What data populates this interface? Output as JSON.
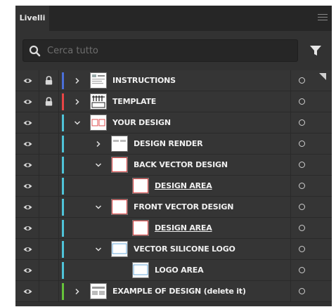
{
  "panel": {
    "tab_label": "Livelli",
    "menu_icon": "hamburger-menu-icon"
  },
  "search": {
    "placeholder": "Cerca tutto",
    "icon": "search-icon",
    "filter_icon": "filter-icon"
  },
  "layers": [
    {
      "label": "INSTRUCTIONS",
      "visible": true,
      "locked": true,
      "color": "#4a6fd8",
      "indent": 0,
      "expanded": false,
      "has_children": true,
      "thumb": "instructions",
      "underline": false
    },
    {
      "label": "TEMPLATE",
      "visible": true,
      "locked": true,
      "color": "#e84545",
      "indent": 0,
      "expanded": false,
      "has_children": true,
      "thumb": "template",
      "underline": false
    },
    {
      "label": "YOUR DESIGN",
      "visible": true,
      "locked": false,
      "color": "#4fc3d8",
      "indent": 0,
      "expanded": true,
      "has_children": true,
      "thumb": "your-design",
      "underline": false
    },
    {
      "label": "DESIGN RENDER",
      "visible": true,
      "locked": false,
      "color": "#4fc3d8",
      "indent": 1,
      "expanded": false,
      "has_children": true,
      "thumb": "render",
      "underline": false
    },
    {
      "label": "BACK VECTOR DESIGN",
      "visible": true,
      "locked": false,
      "color": "#4fc3d8",
      "indent": 1,
      "expanded": true,
      "has_children": true,
      "thumb": "red-frame",
      "underline": false
    },
    {
      "label": "DESIGN AREA",
      "visible": true,
      "locked": false,
      "color": "#4fc3d8",
      "indent": 2,
      "expanded": false,
      "has_children": false,
      "thumb": "red-frame",
      "underline": true
    },
    {
      "label": "FRONT VECTOR DESIGN",
      "visible": true,
      "locked": false,
      "color": "#4fc3d8",
      "indent": 1,
      "expanded": true,
      "has_children": true,
      "thumb": "red-frame",
      "underline": false
    },
    {
      "label": "DESIGN AREA",
      "visible": true,
      "locked": false,
      "color": "#4fc3d8",
      "indent": 2,
      "expanded": false,
      "has_children": false,
      "thumb": "red-frame",
      "underline": true
    },
    {
      "label": "VECTOR SILICONE LOGO",
      "visible": true,
      "locked": false,
      "color": "#4fc3d8",
      "indent": 1,
      "expanded": true,
      "has_children": true,
      "thumb": "blue-frame",
      "underline": false
    },
    {
      "label": "LOGO AREA",
      "visible": true,
      "locked": false,
      "color": "#4fc3d8",
      "indent": 2,
      "expanded": false,
      "has_children": false,
      "thumb": "blue-frame",
      "underline": false
    },
    {
      "label": "EXAMPLE OF DESIGN (delete it)",
      "visible": true,
      "locked": false,
      "color": "#66c23a",
      "indent": 0,
      "expanded": false,
      "has_children": true,
      "thumb": "example",
      "underline": false
    }
  ]
}
